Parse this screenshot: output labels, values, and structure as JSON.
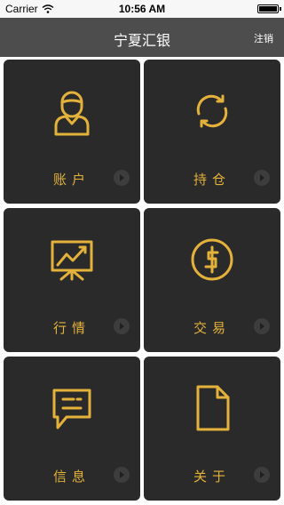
{
  "status_bar": {
    "carrier": "Carrier",
    "time": "10:56 AM"
  },
  "nav": {
    "title": "宁夏汇银",
    "logout_label": "注销"
  },
  "colors": {
    "accent": "#e4b23b",
    "tile": "#2a2a2a",
    "nav": "#4d4d4d"
  },
  "tiles": [
    {
      "label": "账户",
      "icon": "user-icon"
    },
    {
      "label": "持仓",
      "icon": "refresh-cycle-icon"
    },
    {
      "label": "行情",
      "icon": "market-chart-icon"
    },
    {
      "label": "交易",
      "icon": "dollar-coin-icon"
    },
    {
      "label": "信息",
      "icon": "message-icon"
    },
    {
      "label": "关于",
      "icon": "document-icon"
    }
  ]
}
